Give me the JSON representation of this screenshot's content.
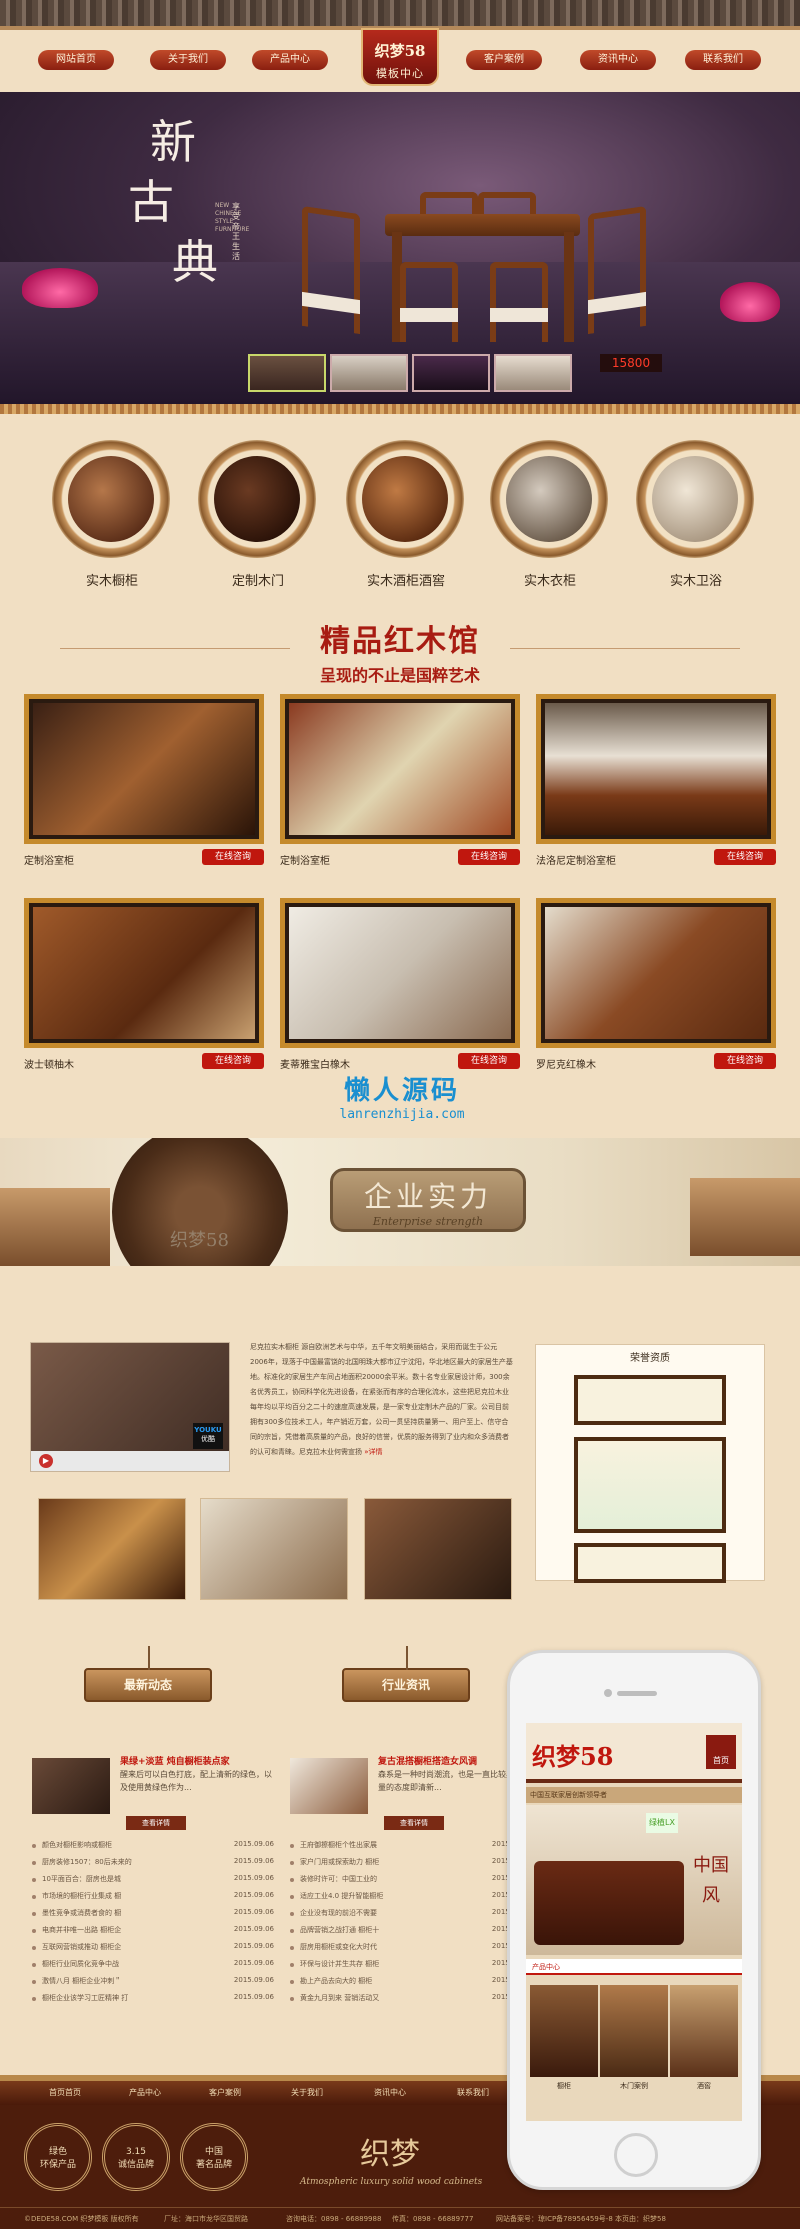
{
  "nav": {
    "items": [
      "网站首页",
      "关于我们",
      "产品中心",
      "客户案例",
      "资讯中心",
      "联系我们"
    ],
    "logo_line1": "织梦58",
    "logo_line2": "模板中心"
  },
  "hero": {
    "title_chars": [
      "新",
      "古",
      "典"
    ],
    "subtitle": "享受帝王生活",
    "en": "NEW CHINESE STYLE FURNITURE",
    "price": "15800"
  },
  "categories": [
    "实木橱柜",
    "定制木门",
    "实木酒柜酒窖",
    "实木衣柜",
    "实木卫浴"
  ],
  "section": {
    "title": "精品红木馆",
    "subtitle": "呈现的不止是国粹艺术"
  },
  "products": [
    {
      "name": "定制浴室柜",
      "btn": "在线咨询"
    },
    {
      "name": "定制浴室柜",
      "btn": "在线咨询"
    },
    {
      "name": "法洛尼定制浴室柜",
      "btn": "在线咨询"
    },
    {
      "name": "波士顿柚木",
      "btn": "在线咨询"
    },
    {
      "name": "麦蒂雅宝白橡木",
      "btn": "在线咨询"
    },
    {
      "name": "罗尼克红橡木",
      "btn": "在线咨询"
    }
  ],
  "watermark": {
    "cn": "懒人源码",
    "url": "lanrenzhijia.com"
  },
  "enterprise": {
    "cn": "企业实力",
    "en": "Enterprise strength",
    "brand": "织梦58"
  },
  "video": {
    "youku_top": "YOUKU",
    "youku_bottom": "优酷",
    "play": "▶"
  },
  "about": {
    "text": "尼克拉实木橱柜 源自欧洲艺术与中华，五千年文明美丽结合，采用而诞生于公元2006年，现落于中国最富饶的北国明珠大都市辽宁沈阳，华北地区最大的家居生产基地。标准化的家居生产车间占地面积20000余平米。数十名专业家居设计师，300余名优秀员工，协同科学化先进设备，在紧张而有序的合理化流水，这些把尼克拉木业每年均以平均百分之二十的速度高速发展，是一家专业定制木产品的厂家。公司目前拥有300多位技术工人，年产销近万套，公司一贯坚持质量第一、用户至上、信守合同的宗旨，凭借着高质量的产品，良好的信誉，优质的服务得到了业内和众多消费者的认可和青睐。尼克拉木业何需宣扬",
    "more": "»详情"
  },
  "honor": {
    "title": "荣誉资质"
  },
  "news": {
    "left": {
      "board": "最新动态",
      "feat_title": "果绿+淡蓝 炖自橱柜装点家",
      "feat_desc": "醒来后可以白色打底，配上清新的绿色，以及使用黄绿色作为...",
      "feat_btn": "查看详情",
      "items": [
        {
          "t": "颜色对橱柜影响或橱柜",
          "d": "2015.09.06"
        },
        {
          "t": "厨房装修1507：80后未来的",
          "d": "2015.09.06"
        },
        {
          "t": "10平面百合：厨房也是城",
          "d": "2015.09.06"
        },
        {
          "t": "市场境的橱柜行业集成 橱",
          "d": "2015.09.06"
        },
        {
          "t": "墨性竞争或消费者食的 橱",
          "d": "2015.09.06"
        },
        {
          "t": "电商并非唯一出路 橱柜企",
          "d": "2015.09.06"
        },
        {
          "t": "互联网营销或推动 橱柜企",
          "d": "2015.09.06"
        },
        {
          "t": "橱柜行业同质化竞争中战",
          "d": "2015.09.06"
        },
        {
          "t": "激情八月 橱柜企业冲刺＂",
          "d": "2015.09.06"
        },
        {
          "t": "橱柜企业该学习工匠精神 打",
          "d": "2015.09.06"
        }
      ]
    },
    "right": {
      "board": "行业资讯",
      "feat_title": "复古混搭橱柜搭造女风调",
      "feat_desc": "森系是一种时尚潮流，也是一直比较具有大量的态度即清新...",
      "feat_btn": "查看详情",
      "items": [
        {
          "t": "王府御擦橱柜个性出家展",
          "d": "2015.09.06"
        },
        {
          "t": "家户门用或探索助力 橱柜",
          "d": "2015.09.06"
        },
        {
          "t": "装修时许可：中国工业的",
          "d": "2015.09.06"
        },
        {
          "t": "适应工业4.0 提升智能橱柜",
          "d": "2015.09.06"
        },
        {
          "t": "企业没有现的前沿不需要",
          "d": "2015.09.06"
        },
        {
          "t": "品牌营销之战打通 橱柜十",
          "d": "2015.09.06"
        },
        {
          "t": "厨房用橱柜或变化大时代",
          "d": "2015.09.06"
        },
        {
          "t": "环保与设计并生共存 橱柜",
          "d": "2015.09.06"
        },
        {
          "t": "勘上产品去向大的 橱柜",
          "d": "2015.09.06"
        },
        {
          "t": "黄金九月到来 营销活动又",
          "d": "2015.09.06"
        }
      ]
    }
  },
  "phone": {
    "logo": "织梦58",
    "home": "首页",
    "strip": "中国互联家居创新领导者",
    "green_badge": "绿植LX",
    "mark": "中国风",
    "section": "产品中心",
    "products": [
      "橱柜",
      "木门案例",
      "酒窖"
    ]
  },
  "footer": {
    "nav": [
      "首页首页",
      "产品中心",
      "客户案例",
      "关于我们",
      "资讯中心",
      "联系我们"
    ],
    "medals": [
      {
        "l1": "绿色",
        "l2": "环保产品"
      },
      {
        "l1": "3.15",
        "l2": "诚信品牌"
      },
      {
        "l1": "中国",
        "l2": "著名品牌"
      }
    ],
    "brand": "织梦",
    "slogan": "Atmospheric luxury solid wood cabinets",
    "copy": [
      "©DEDE58.COM 织梦模板 版权所有",
      "厂址：海口市龙华区国贸路",
      "咨询电话：0898 - 66889988",
      "传真：0898 - 66889777",
      "网站备案号：琼ICP备78956459号-8 本页由：织梦58"
    ]
  }
}
